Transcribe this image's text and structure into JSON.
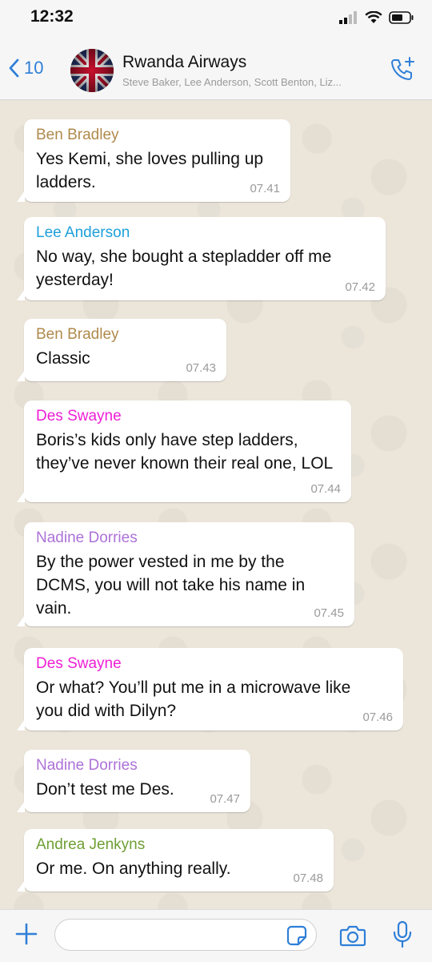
{
  "status": {
    "time": "12:32"
  },
  "header": {
    "back_count": "10",
    "title": "Rwanda Airways",
    "subtitle": "Steve Baker, Lee Anderson, Scott Benton, Liz..."
  },
  "colors": {
    "accent": "#2f7fd8",
    "ben": "#b08a4c",
    "lee": "#1ea0db",
    "des": "#ee1fd6",
    "nadine": "#ad72d8",
    "andrea": "#6f9f35"
  },
  "messages": [
    {
      "sender": "Ben Bradley",
      "text": "Yes Kemi, she loves pulling up ladders.",
      "time": "07.41"
    },
    {
      "sender": "Lee Anderson",
      "text": "No way, she bought a stepladder off me yesterday!",
      "time": "07.42"
    },
    {
      "sender": "Ben Bradley",
      "text": "Classic",
      "time": "07.43"
    },
    {
      "sender": "Des Swayne",
      "text": "Boris’s kids only have step ladders, they’ve never known their real one, LOL",
      "time": "07.44"
    },
    {
      "sender": "Nadine Dorries",
      "text": "By the power vested in me by the DCMS, you will not take his name in vain.",
      "time": "07.45"
    },
    {
      "sender": "Des Swayne",
      "text": "Or what?  You’ll put me in a microwave like you did with Dilyn?",
      "time": "07.46"
    },
    {
      "sender": "Nadine Dorries",
      "text": "Don’t test me Des.",
      "time": "07.47"
    },
    {
      "sender": "Andrea Jenkyns",
      "text": "Or me. On anything really.",
      "time": "07.48"
    }
  ],
  "input": {
    "placeholder": ""
  }
}
